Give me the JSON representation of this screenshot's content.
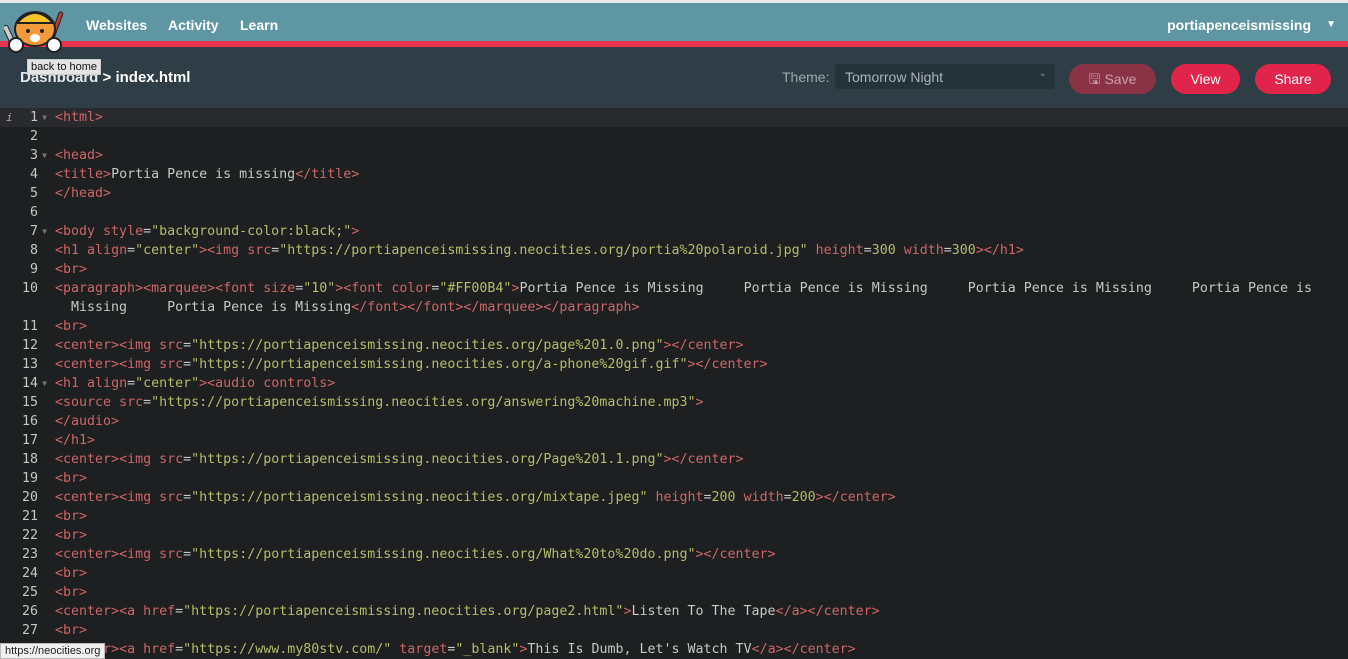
{
  "nav": {
    "items": [
      "Websites",
      "Activity",
      "Learn"
    ],
    "user": "portiapenceismissing",
    "logo_tooltip": "back to home"
  },
  "breadcrumb": {
    "parent": "Dashboard",
    "separator": ">",
    "file": "index.html"
  },
  "toolbar": {
    "theme_label": "Theme:",
    "theme_value": "Tomorrow Night",
    "save_label": "Save",
    "view_label": "View",
    "share_label": "Share"
  },
  "colors": {
    "accent": "#e93250",
    "topbar": "#5e97a3",
    "tag": "#cc6666",
    "string": "#b5bd68",
    "text": "#c5c8c6",
    "background": "#1d1f21"
  },
  "status_url": "https://neocities.org",
  "editor": {
    "active_line": 1,
    "fold_lines": [
      1,
      3,
      7,
      14
    ],
    "lines": [
      "<html>",
      "",
      "<head>",
      "<title>Portia Pence is missing</title>",
      "</head>",
      "",
      "<body style=\"background-color:black;\">",
      "<h1 align=\"center\"><img src=\"https://portiapenceismissing.neocities.org/portia%20polaroid.jpg\" height=300 width=300></h1>",
      "<br>",
      "<paragraph><marquee><font size=\"10\"><font color=\"#FF00B4\">Portia Pence is Missing     Portia Pence is Missing     Portia Pence is Missing     Portia Pence is Missing     Portia Pence is Missing</font></font></marquee></paragraph>",
      "<br>",
      "<center><img src=\"https://portiapenceismissing.neocities.org/page%201.0.png\"></center>",
      "<center><img src=\"https://portiapenceismissing.neocities.org/a-phone%20gif.gif\"></center>",
      "<h1 align=\"center\"><audio controls>",
      "<source src=\"https://portiapenceismissing.neocities.org/answering%20machine.mp3\">",
      "</audio>",
      "</h1>",
      "<center><img src=\"https://portiapenceismissing.neocities.org/Page%201.1.png\"></center>",
      "<br>",
      "<center><img src=\"https://portiapenceismissing.neocities.org/mixtape.jpeg\" height=200 width=200></center>",
      "<br>",
      "<br>",
      "<center><img src=\"https://portiapenceismissing.neocities.org/What%20to%20do.png\"></center>",
      "<br>",
      "<br>",
      "<center><a href=\"https://portiapenceismissing.neocities.org/page2.html\">Listen To The Tape</a></center>",
      "<br>",
      "<center><a href=\"https://www.my80stv.com/\" target=\"_blank\">This Is Dumb, Let's Watch TV</a></center>"
    ]
  }
}
